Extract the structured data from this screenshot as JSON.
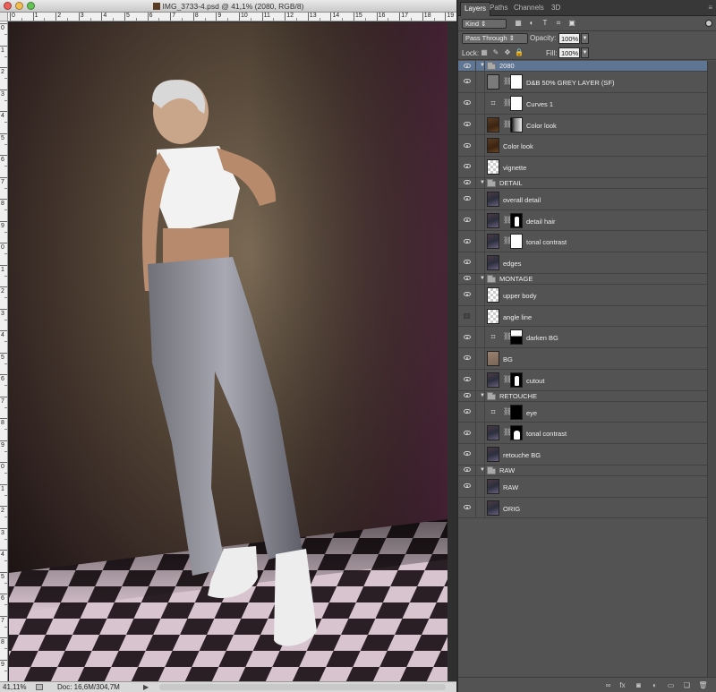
{
  "document": {
    "title": "IMG_3733-4.psd @ 41,1% (2080, RGB/8)",
    "zoom": "41,11%",
    "doc_size": "Doc: 16,6M/304,7M",
    "ruler_top": [
      "0",
      "1",
      "2",
      "3",
      "4",
      "5",
      "6",
      "7",
      "8",
      "9",
      "10",
      "11",
      "12",
      "13",
      "14",
      "15",
      "16",
      "17",
      "18",
      "19"
    ],
    "ruler_left": [
      "0",
      "1",
      "2",
      "3",
      "4",
      "5",
      "6",
      "7",
      "8",
      "9",
      "0",
      "1",
      "2",
      "3",
      "4",
      "5",
      "6",
      "7",
      "8",
      "9",
      "0",
      "1",
      "2",
      "3",
      "4",
      "5",
      "6",
      "7",
      "8",
      "9"
    ]
  },
  "panel": {
    "tabs": [
      "Layers",
      "Paths",
      "Channels",
      "3D"
    ],
    "kind_label": "Kind",
    "blend_mode": "Pass Through",
    "opacity_label": "Opacity:",
    "opacity_value": "100%",
    "lock_label": "Lock:",
    "fill_label": "Fill:",
    "fill_value": "100%"
  },
  "layers": [
    {
      "type": "group",
      "name": "2080",
      "indent": 0,
      "visible": true,
      "selected": true
    },
    {
      "type": "layer",
      "name": "D&B 50% GREY LAYER (SF)",
      "indent": 1,
      "visible": true,
      "thumb": "gray",
      "mask": "white"
    },
    {
      "type": "layer",
      "name": "Curves 1",
      "indent": 1,
      "visible": true,
      "thumb": "adj",
      "mask": "white"
    },
    {
      "type": "layer",
      "name": "Color look",
      "indent": 1,
      "visible": true,
      "thumb": "brown",
      "mask": "grad"
    },
    {
      "type": "layer",
      "name": "Color look",
      "indent": 1,
      "visible": true,
      "thumb": "brown",
      "mask": ""
    },
    {
      "type": "layer",
      "name": "vignette",
      "indent": 1,
      "visible": true,
      "thumb": "trans",
      "mask": ""
    },
    {
      "type": "group",
      "name": "DETAIL",
      "indent": 0,
      "visible": true
    },
    {
      "type": "layer",
      "name": "overall detail",
      "indent": 1,
      "visible": true,
      "thumb": "photo",
      "mask": ""
    },
    {
      "type": "layer",
      "name": "detail hair",
      "indent": 1,
      "visible": true,
      "thumb": "photo",
      "mask": "cut"
    },
    {
      "type": "layer",
      "name": "tonal contrast",
      "indent": 1,
      "visible": true,
      "thumb": "photo",
      "mask": "white"
    },
    {
      "type": "layer",
      "name": "edges",
      "indent": 1,
      "visible": true,
      "thumb": "photo",
      "mask": ""
    },
    {
      "type": "group",
      "name": "MONTAGE",
      "indent": 0,
      "visible": true
    },
    {
      "type": "layer",
      "name": "upper body",
      "indent": 1,
      "visible": true,
      "thumb": "trans",
      "mask": ""
    },
    {
      "type": "layer",
      "name": "angle line",
      "indent": 1,
      "visible": false,
      "thumb": "trans",
      "mask": ""
    },
    {
      "type": "layer",
      "name": "darken BG",
      "indent": 1,
      "visible": true,
      "thumb": "adj",
      "mask": "dark"
    },
    {
      "type": "layer",
      "name": "BG",
      "indent": 1,
      "visible": true,
      "thumb": "bg",
      "mask": ""
    },
    {
      "type": "layer",
      "name": "cutout",
      "indent": 1,
      "visible": true,
      "thumb": "photo",
      "mask": "cut"
    },
    {
      "type": "group",
      "name": "RETOUCHE",
      "indent": 0,
      "visible": true
    },
    {
      "type": "layer",
      "name": "eye",
      "indent": 1,
      "visible": true,
      "thumb": "adj",
      "mask": "black"
    },
    {
      "type": "layer",
      "name": "tonal contrast",
      "indent": 1,
      "visible": true,
      "thumb": "photo",
      "mask": "cut2"
    },
    {
      "type": "layer",
      "name": "retouche BG",
      "indent": 1,
      "visible": true,
      "thumb": "photo",
      "mask": ""
    },
    {
      "type": "group",
      "name": "RAW",
      "indent": 0,
      "visible": true
    },
    {
      "type": "layer",
      "name": "RAW",
      "indent": 1,
      "visible": true,
      "thumb": "photo",
      "mask": ""
    },
    {
      "type": "layer",
      "name": "ORIG",
      "indent": 1,
      "visible": true,
      "thumb": "photo",
      "mask": ""
    }
  ],
  "bottom_icons": [
    "link-layers-icon",
    "fx-icon",
    "add-mask-icon",
    "adjustment-icon",
    "new-group-icon",
    "new-layer-icon",
    "delete-icon"
  ]
}
